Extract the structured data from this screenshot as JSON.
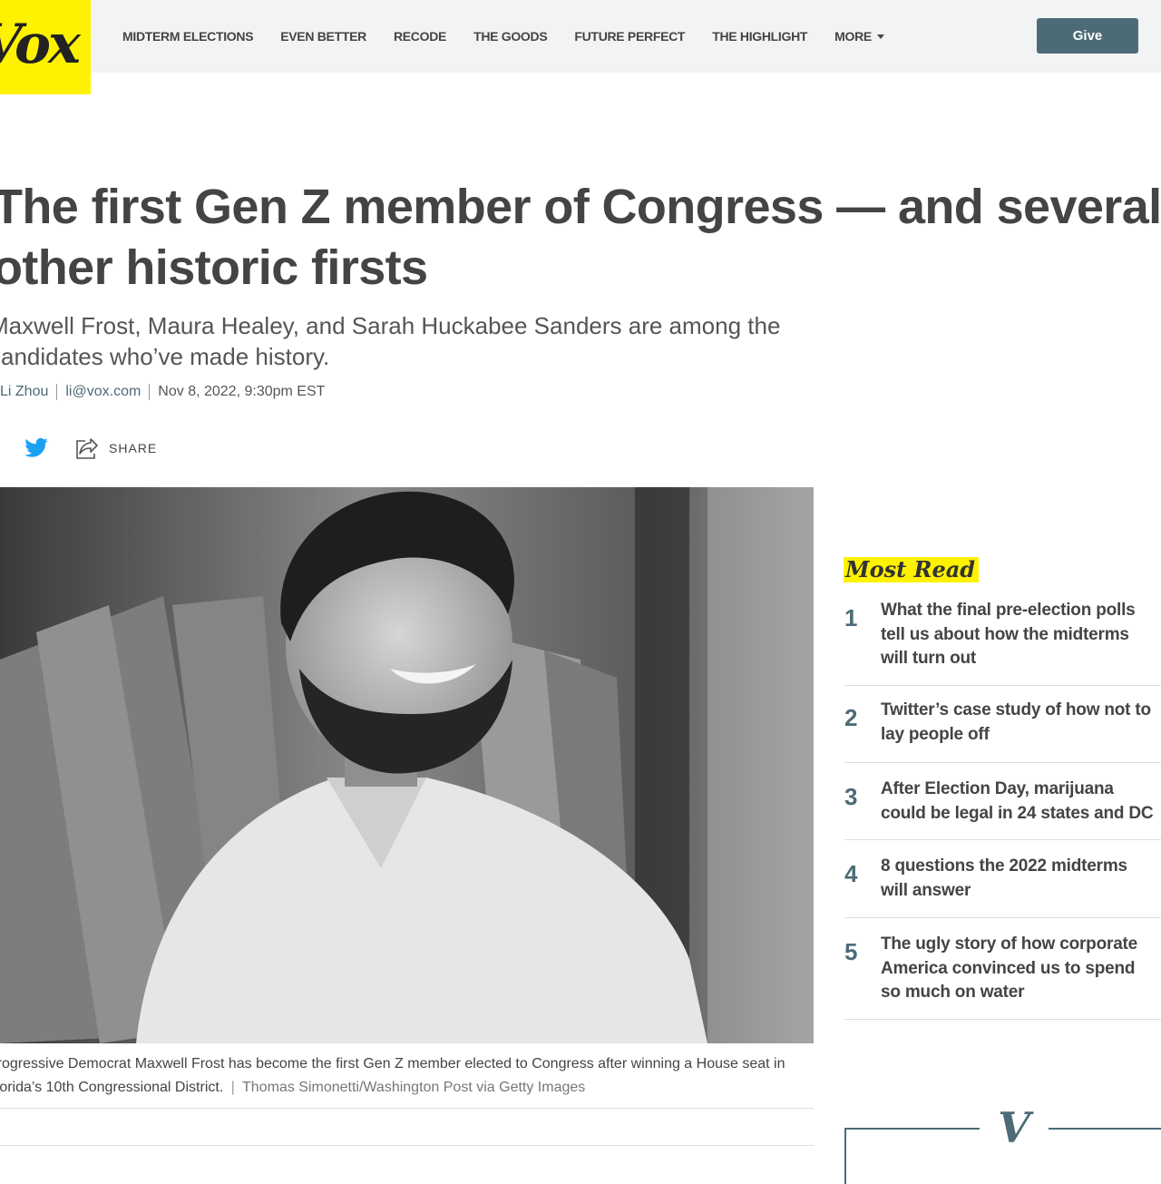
{
  "header": {
    "logo_text": "Vox",
    "nav": [
      "Midterm Elections",
      "Even Better",
      "Recode",
      "The Goods",
      "Future Perfect",
      "The Highlight"
    ],
    "more_label": "More",
    "give_label": "Give"
  },
  "article": {
    "headline": "The first Gen Z member of Congress — and several other historic firsts",
    "dek": "Maxwell Frost, Maura Healey, and Sarah Huckabee Sanders are among the candidates who’ve made history.",
    "author": "Li Zhou",
    "email": "li@vox.com",
    "date": "Nov 8, 2022, 9:30pm EST",
    "share_label": "SHARE",
    "caption": "Progressive Democrat Maxwell Frost has become the first Gen Z member elected to Congress after winning a House seat in Florida’s 10th Congressional District.",
    "caption_sep": "|",
    "credit": "Thomas Simonetti/Washington Post via Getty Images"
  },
  "most_read": {
    "title": "Most Read",
    "items": [
      {
        "num": "1",
        "lines": [
          "What the final pre-election polls",
          "tell us about how the midterms",
          "will turn out"
        ]
      },
      {
        "num": "2",
        "lines": [
          "Twitter’s case study of how not to",
          "lay people off"
        ]
      },
      {
        "num": "3",
        "lines": [
          "After Election Day, marijuana",
          "could be legal in 24 states and DC"
        ]
      },
      {
        "num": "4",
        "lines": [
          "8 questions the 2022 midterms",
          "will answer"
        ]
      },
      {
        "num": "5",
        "lines": [
          "The ugly story of how corporate",
          "America convinced us to spend",
          "so much on water"
        ]
      }
    ]
  },
  "footer_mark": "V",
  "colors": {
    "brand_yellow": "#fff200",
    "accent": "#4c6b77",
    "twitter": "#1da1f2"
  }
}
